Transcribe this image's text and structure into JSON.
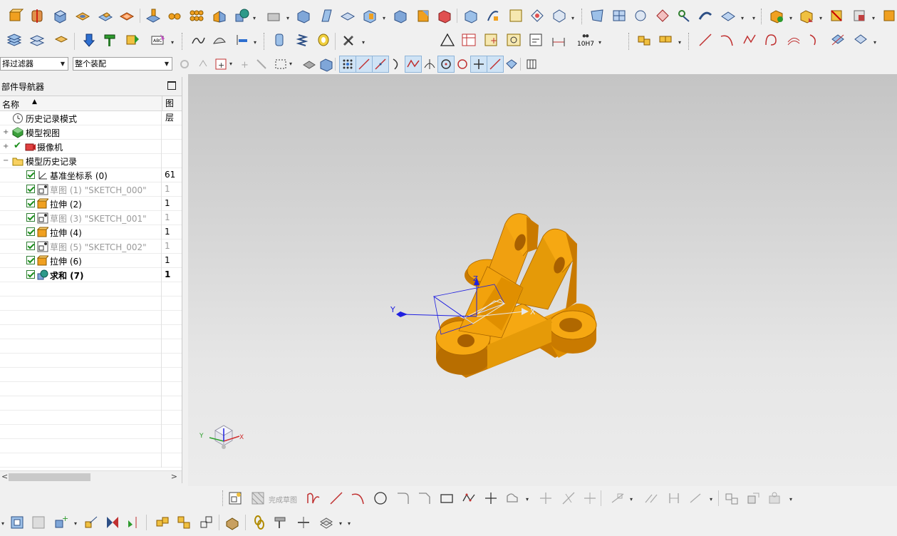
{
  "filters": {
    "selection_filter": "择过滤器",
    "scope": "整个装配"
  },
  "navigator": {
    "title": "部件导航器",
    "columns": {
      "name": "名称",
      "layer": "图层"
    },
    "rows": [
      {
        "label": "历史记录模式",
        "layer": "",
        "style": "normal"
      },
      {
        "label": "模型视图",
        "layer": "",
        "style": "normal"
      },
      {
        "label": "摄像机",
        "layer": "",
        "style": "normal"
      },
      {
        "label": "模型历史记录",
        "layer": "",
        "style": "normal"
      },
      {
        "label": "基准坐标系 (0)",
        "layer": "61",
        "style": "normal"
      },
      {
        "label": "草图 (1) \"SKETCH_000\"",
        "layer": "1",
        "style": "grey"
      },
      {
        "label": "拉伸 (2)",
        "layer": "1",
        "style": "normal"
      },
      {
        "label": "草图 (3) \"SKETCH_001\"",
        "layer": "1",
        "style": "grey"
      },
      {
        "label": "拉伸 (4)",
        "layer": "1",
        "style": "normal"
      },
      {
        "label": "草图 (5) \"SKETCH_002\"",
        "layer": "1",
        "style": "grey"
      },
      {
        "label": "拉伸 (6)",
        "layer": "1",
        "style": "normal"
      },
      {
        "label": "求和 (7)",
        "layer": "1",
        "style": "bold"
      }
    ]
  },
  "viewport": {
    "csys_labels": {
      "x": "X",
      "y": "Y",
      "z": "Z"
    },
    "part_color": "#f2a20c",
    "part_shadow": "#c97a00"
  },
  "sketch_toolbar": {
    "finish_sketch": "完成草图"
  },
  "toolbar_extra": {
    "fit_label": "10H7"
  }
}
